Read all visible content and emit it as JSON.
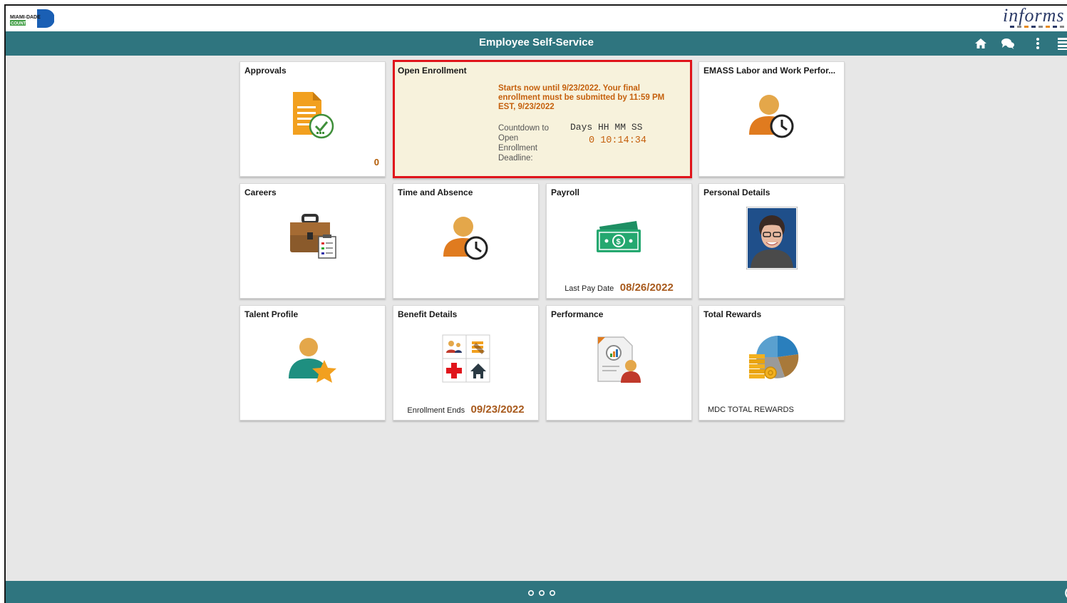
{
  "header": {
    "title": "Employee Self-Service",
    "logo_text_top": "MIAMI-DADE",
    "logo_text_bottom": "COUNTY",
    "brand": "informs",
    "icons": [
      "home-icon",
      "chat-icon",
      "more-icon",
      "navbar-icon"
    ]
  },
  "colors": {
    "header_bg": "#2f757f",
    "page_bg": "#e7e7e7",
    "accent_orange": "#c5600d",
    "highlight_border": "#e0141b"
  },
  "tiles": {
    "approvals": {
      "title": "Approvals",
      "count": "0"
    },
    "open_enrollment": {
      "title": "Open Enrollment",
      "message": "Starts now until 9/23/2022. Your final enrollment must be submitted by 11:59 PM EST, 9/23/2022",
      "countdown_label": "Countdown to Open Enrollment Deadline:",
      "countdown_head": "Days HH MM SS",
      "countdown_value": "0 10:14:34"
    },
    "emass": {
      "title": "EMASS Labor and Work Perfor..."
    },
    "careers": {
      "title": "Careers"
    },
    "time_absence": {
      "title": "Time and Absence"
    },
    "payroll": {
      "title": "Payroll",
      "foot_label": "Last Pay Date",
      "foot_value": "08/26/2022"
    },
    "personal_details": {
      "title": "Personal Details"
    },
    "talent_profile": {
      "title": "Talent Profile"
    },
    "benefit_details": {
      "title": "Benefit Details",
      "foot_label": "Enrollment Ends",
      "foot_value": "09/23/2022"
    },
    "performance": {
      "title": "Performance"
    },
    "total_rewards": {
      "title": "Total Rewards",
      "foot_label": "MDC TOTAL REWARDS"
    }
  }
}
